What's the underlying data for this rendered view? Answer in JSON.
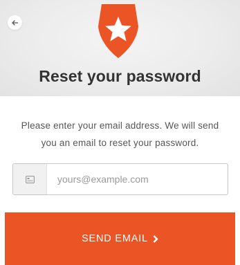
{
  "header": {
    "title": "Reset your password",
    "back_icon": "arrow-left-icon",
    "logo_icon": "auth0-shield-star-logo",
    "brand_color": "#eb5424"
  },
  "form": {
    "instructions": "Please enter your email address. We will send you an email to reset your password.",
    "email": {
      "value": "",
      "placeholder": "yours@example.com",
      "icon": "envelope-icon"
    },
    "submit_label": "SEND EMAIL",
    "submit_icon": "chevron-right-icon"
  }
}
